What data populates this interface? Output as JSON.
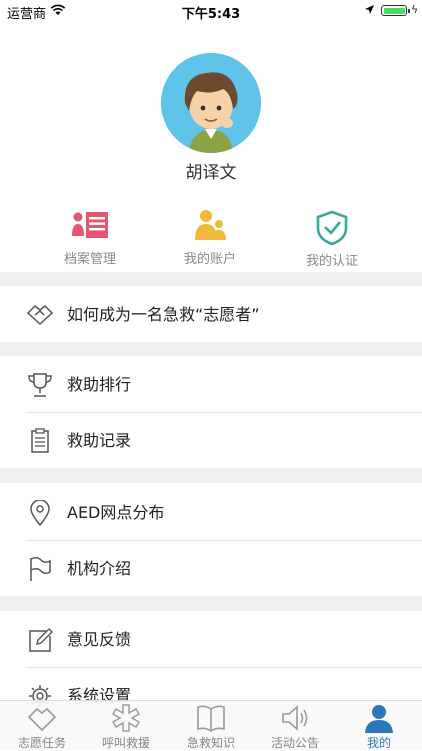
{
  "status_bar": {
    "carrier": "运营商",
    "time": "下午5:43"
  },
  "profile": {
    "name": "胡译文"
  },
  "quick_actions": [
    {
      "label": "档案管理",
      "icon": "profile-card-icon"
    },
    {
      "label": "我的账户",
      "icon": "account-icon"
    },
    {
      "label": "我的认证",
      "icon": "shield-check-icon"
    }
  ],
  "menu": {
    "volunteer": "如何成为一名急救“志愿者”",
    "ranking": "救助排行",
    "records": "救助记录",
    "aed": "AED网点分布",
    "org": "机构介绍",
    "feedback": "意见反馈",
    "settings": "系统设置"
  },
  "tabbar": {
    "items": [
      {
        "label": "志愿任务",
        "icon": "task-icon"
      },
      {
        "label": "呼叫救援",
        "icon": "rescue-icon"
      },
      {
        "label": "急救知识",
        "icon": "book-icon"
      },
      {
        "label": "活动公告",
        "icon": "speaker-icon"
      },
      {
        "label": "我的",
        "icon": "user-icon"
      }
    ],
    "active": "我的"
  },
  "colors": {
    "accent": "#2b77b8",
    "red": "#e4566f",
    "yellow": "#f0b93a",
    "teal": "#3aa79b",
    "avatar_bg": "#5fc3ea"
  }
}
